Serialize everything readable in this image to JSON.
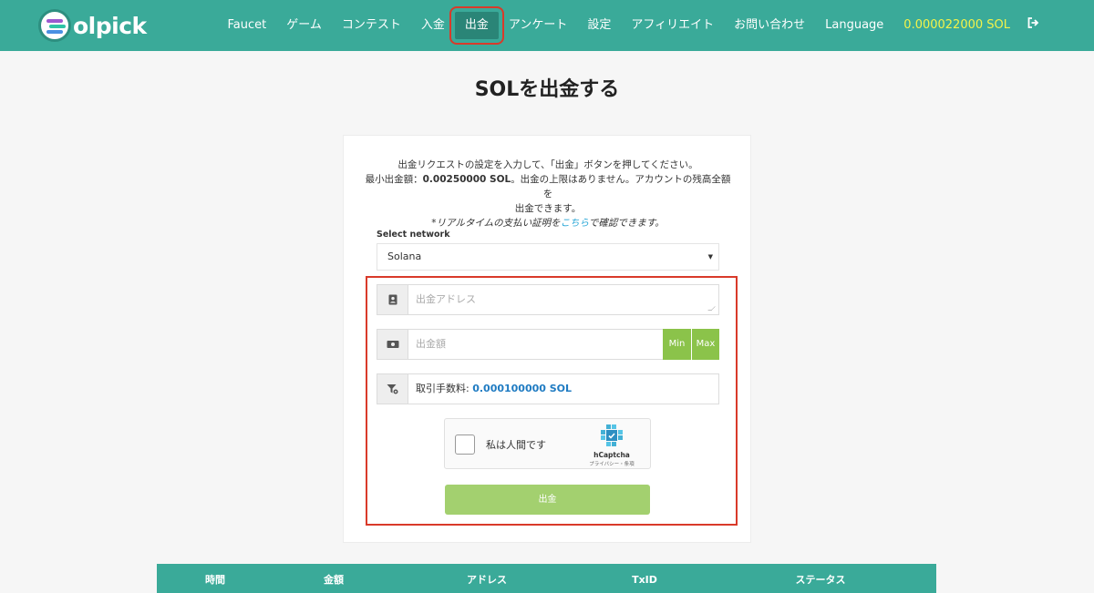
{
  "header": {
    "logo_text": "olpick",
    "nav": [
      {
        "label": "Faucet"
      },
      {
        "label": "ゲーム"
      },
      {
        "label": "コンテスト"
      },
      {
        "label": "入金"
      },
      {
        "label": "出金"
      },
      {
        "label": "アンケート"
      },
      {
        "label": "設定"
      },
      {
        "label": "アフィリエイト"
      },
      {
        "label": "お問い合わせ"
      },
      {
        "label": "Language"
      }
    ],
    "balance": "0.000022000 SOL",
    "logout_icon": "sign-out-icon"
  },
  "page_title": "SOLを出金する",
  "form": {
    "intro_line1": "出金リクエストの設定を入力して、「出金」ボタンを押してください。",
    "intro_line2_prefix": "最小出金額：",
    "intro_min_amount": "0.00250000 SOL",
    "intro_line2_suffix": "。出金の上限はありません。アカウントの残高全額を",
    "intro_line3": "出金できます。",
    "intro_line4_prefix": "*リアルタイムの支払い証明を",
    "intro_link": "こちら",
    "intro_line4_suffix": "で確認できます。",
    "network_label": "Select network",
    "network_value": "Solana",
    "address_placeholder": "出金アドレス",
    "amount_placeholder": "出金額",
    "min_label": "Min",
    "max_label": "Max",
    "fee_label": "取引手数料: ",
    "fee_value": "0.000100000 SOL",
    "captcha_label": "私は人間です",
    "captcha_brand": "hCaptcha",
    "captcha_terms": "プライバシー・条項",
    "submit_label": "出金"
  },
  "table": {
    "headers": [
      "時間",
      "金額",
      "アドレス",
      "TxID",
      "ステータス"
    ]
  },
  "colors": {
    "primary": "#3aaa99",
    "accent_green": "#8bc34a",
    "highlight_red": "#d93a2a",
    "balance_yellow": "#f3f34a"
  }
}
